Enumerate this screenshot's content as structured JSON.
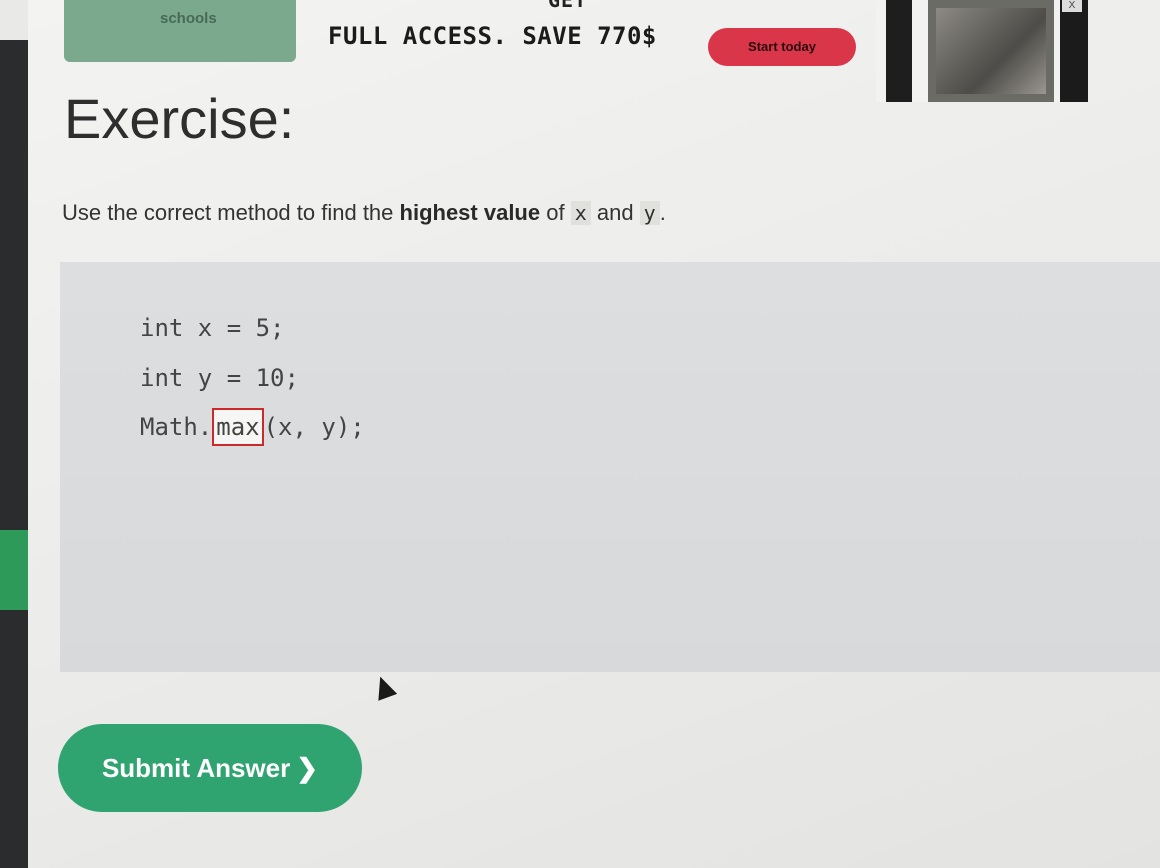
{
  "banner": {
    "logo_text": "schools",
    "promo_top": "GET",
    "promo_text": "FULL ACCESS. SAVE 770$",
    "cta_label": "Start today",
    "close_label": "X"
  },
  "exercise": {
    "title": "Exercise:",
    "instruction_pre": "Use the correct method to find the ",
    "instruction_bold": "highest value",
    "instruction_of": " of ",
    "var_x": "x",
    "instruction_and": " and ",
    "var_y": "y",
    "instruction_end": "."
  },
  "code": {
    "line1": "int x = 5;",
    "line2": "int y = 10;",
    "line3_prefix": "Math.",
    "answer_value": "max",
    "line3_suffix": "(x, y);"
  },
  "submit": {
    "label": "Submit Answer",
    "chevron": "❯"
  },
  "colors": {
    "accent_green": "#2fa370",
    "cta_red": "#d9364a",
    "answer_border": "#cc2a2a"
  }
}
